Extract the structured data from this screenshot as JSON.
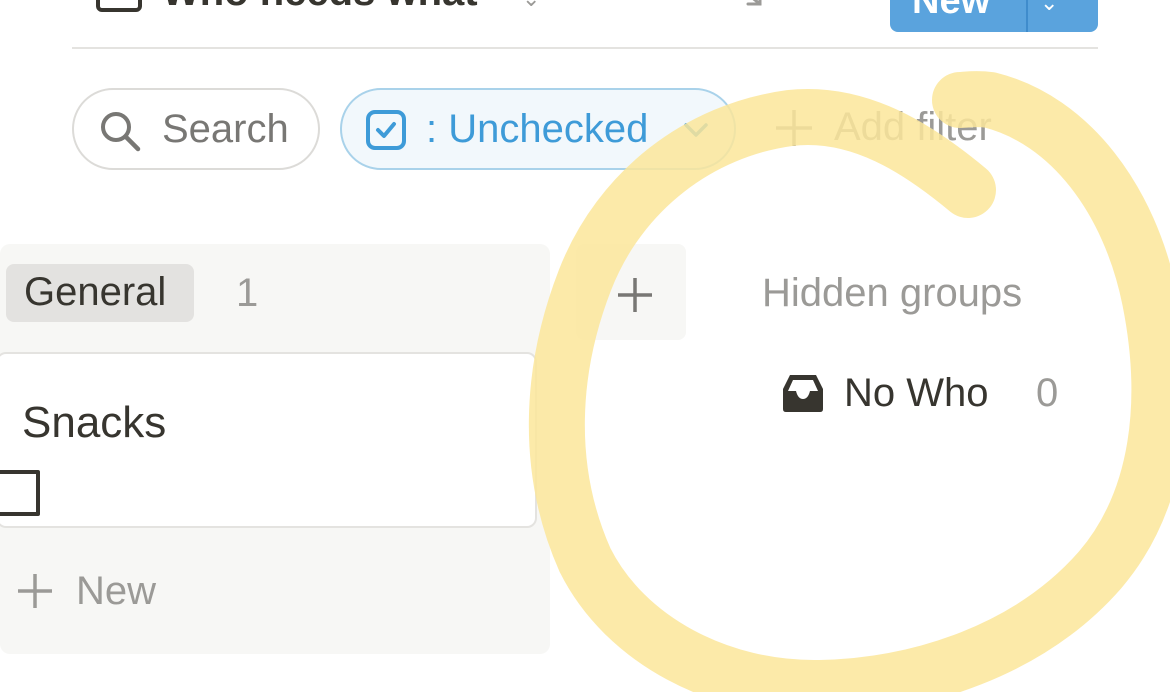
{
  "header": {
    "title": "Who needs what",
    "new_button_label": "New"
  },
  "filters": {
    "search_label": "Search",
    "active_filter_label": ": Unchecked",
    "add_filter_label": "Add filter"
  },
  "board": {
    "column": {
      "group_name": "General",
      "count": "1",
      "cards": [
        {
          "title": "Snacks",
          "checked": false
        }
      ],
      "new_label": "New"
    }
  },
  "hidden_groups": {
    "title": "Hidden groups",
    "items": [
      {
        "label": "No Who",
        "count": "0",
        "icon": "inbox-icon"
      }
    ]
  },
  "annotation": {
    "highlight_color": "#fbe69a"
  },
  "colors": {
    "accent": "#5aa3dd",
    "filter_text": "#3e9bd8",
    "muted_text": "#9b9a97",
    "column_bg": "#f7f7f5"
  }
}
